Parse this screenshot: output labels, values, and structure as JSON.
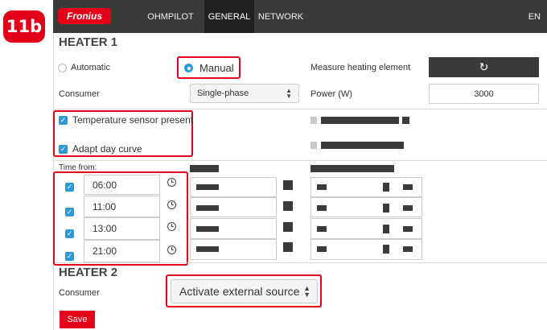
{
  "badge": "11b",
  "header": {
    "logo": "Fronius",
    "tabs": [
      {
        "label": "OHMPILOT",
        "active": false
      },
      {
        "label": "GENERAL",
        "active": true
      },
      {
        "label": "NETWORK",
        "active": false
      }
    ],
    "language": "EN"
  },
  "heater1": {
    "title": "HEATER 1",
    "mode_options": [
      {
        "label": "Automatic",
        "selected": false
      },
      {
        "label": "Manual",
        "selected": true
      }
    ],
    "measure_label": "Measure heating element",
    "measure_button_icon": "refresh-icon",
    "consumer_label": "Consumer",
    "consumer_value": "Single-phase",
    "power_label": "Power (W)",
    "power_value": "3000",
    "checkboxes": [
      {
        "label": "Temperature sensor present",
        "checked": true
      },
      {
        "label": "Adapt day curve",
        "checked": true
      }
    ],
    "time_from_label": "Time from:",
    "times": [
      {
        "value": "06:00",
        "checked": true
      },
      {
        "value": "11:00",
        "checked": true
      },
      {
        "value": "13:00",
        "checked": true
      },
      {
        "value": "21:00",
        "checked": true
      }
    ]
  },
  "heater2": {
    "title": "HEATER 2",
    "consumer_label": "Consumer",
    "consumer_value": "Activate external source"
  },
  "save_label": "Save",
  "colors": {
    "accent": "#e2001a",
    "header": "#3b3b3b",
    "checkbox": "#2b9bd8"
  }
}
